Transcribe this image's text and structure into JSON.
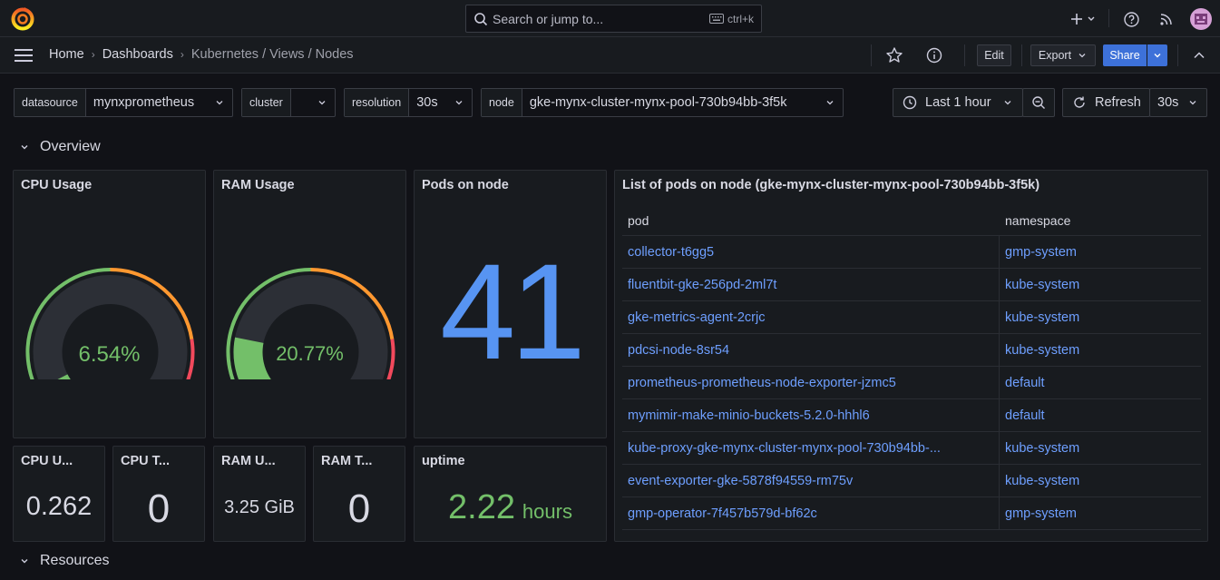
{
  "topbar": {
    "search_placeholder": "Search or jump to...",
    "search_shortcut": "ctrl+k",
    "icons": [
      "grafana-logo-icon",
      "search-icon",
      "keyboard-icon",
      "plus-icon",
      "help-icon",
      "rss-icon",
      "avatar"
    ]
  },
  "breadcrumb": {
    "home": "Home",
    "dashboards": "Dashboards",
    "current": "Kubernetes / Views / Nodes"
  },
  "toolbar": {
    "edit": "Edit",
    "export": "Export",
    "share": "Share"
  },
  "variables": [
    {
      "label": "datasource",
      "value": "mynxprometheus"
    },
    {
      "label": "cluster",
      "value": ""
    },
    {
      "label": "resolution",
      "value": "30s"
    },
    {
      "label": "node",
      "value": "gke-mynx-cluster-mynx-pool-730b94bb-3f5k"
    }
  ],
  "time": {
    "range": "Last 1 hour",
    "refresh_label": "Refresh",
    "refresh_interval": "30s"
  },
  "rows": {
    "overview": "Overview",
    "resources": "Resources"
  },
  "panels": {
    "cpu_usage": {
      "title": "CPU Usage",
      "value": "6.54%",
      "fraction": 0.0654
    },
    "ram_usage": {
      "title": "RAM Usage",
      "value": "20.77%",
      "fraction": 0.2077
    },
    "pods_on_node": {
      "title": "Pods on node",
      "value": "41"
    },
    "cpu_u": {
      "title": "CPU U...",
      "value": "0.262"
    },
    "cpu_t": {
      "title": "CPU T...",
      "value": "0"
    },
    "ram_u": {
      "title": "RAM U...",
      "value": "3.25 GiB"
    },
    "ram_t": {
      "title": "RAM T...",
      "value": "0"
    },
    "uptime": {
      "title": "uptime",
      "value": "2.22",
      "unit": "hours"
    }
  },
  "pods_table": {
    "title": "List of pods on node (gke-mynx-cluster-mynx-pool-730b94bb-3f5k)",
    "columns": [
      "pod",
      "namespace"
    ],
    "rows": [
      {
        "pod": "collector-t6gg5",
        "namespace": "gmp-system"
      },
      {
        "pod": "fluentbit-gke-256pd-2ml7t",
        "namespace": "kube-system"
      },
      {
        "pod": "gke-metrics-agent-2crjc",
        "namespace": "kube-system"
      },
      {
        "pod": "pdcsi-node-8sr54",
        "namespace": "kube-system"
      },
      {
        "pod": "prometheus-prometheus-node-exporter-jzmc5",
        "namespace": "default"
      },
      {
        "pod": "mymimir-make-minio-buckets-5.2.0-hhhl6",
        "namespace": "default"
      },
      {
        "pod": "kube-proxy-gke-mynx-cluster-mynx-pool-730b94bb-...",
        "namespace": "kube-system"
      },
      {
        "pod": "event-exporter-gke-5878f94559-rm75v",
        "namespace": "kube-system"
      },
      {
        "pod": "gmp-operator-7f457b579d-bf62c",
        "namespace": "gmp-system"
      }
    ]
  },
  "colors": {
    "green": "#73bf69",
    "orange": "#ff9830",
    "red": "#f2495c",
    "blue": "#5794f2",
    "link": "#6e9fff"
  }
}
